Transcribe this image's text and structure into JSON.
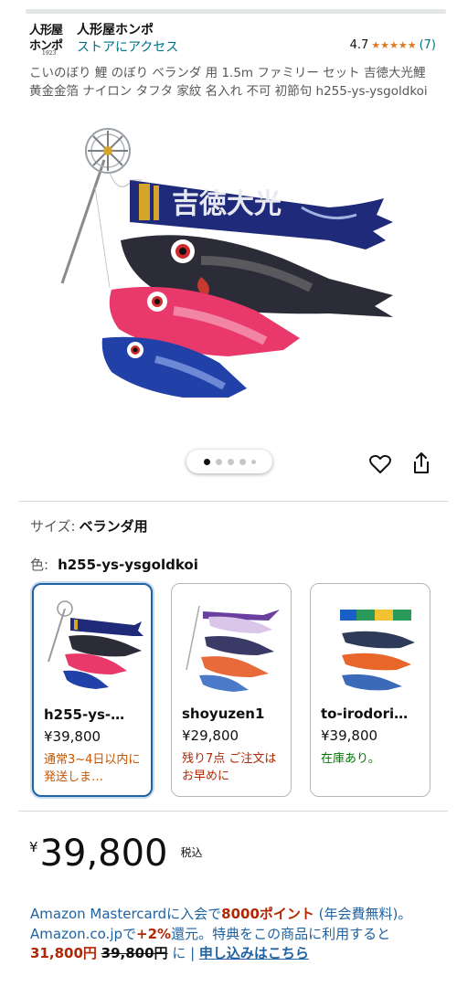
{
  "store": {
    "logo_line1": "人形屋",
    "logo_line2": "ホンポ",
    "logo_year": "1923",
    "name": "人形屋ホンポ",
    "link": "ストアにアクセス",
    "rating": "4.7",
    "stars": "★★★★★",
    "review_count": "(7)"
  },
  "product": {
    "title": "こいのぼり 鯉 のぼり ベランダ 用 1.5m ファミリー セット 吉徳大光鯉 黄金金箔 ナイロン タフタ 家紋 名入れ 不可 初節句 h255-ys-ysgoldkoi",
    "banner_text": "吉徳大光"
  },
  "carousel": {
    "dot_count": 5,
    "active_index": 0
  },
  "options": {
    "size_label": "サイズ:",
    "size_value": "ベランダ用",
    "color_label": "色:",
    "color_value": "h255-ys-ysgoldkoi",
    "swatches": [
      {
        "name": "h255-ys-…",
        "price": "¥39,800",
        "stock": "通常3~4日以内に発送しま…",
        "stock_color": "orange"
      },
      {
        "name": "shoyuzen1",
        "price": "¥29,800",
        "stock": "残り7点 ご注文はお早めに",
        "stock_color": "red"
      },
      {
        "name": "to-irodori…",
        "price": "¥39,800",
        "stock": "在庫あり。",
        "stock_color": "green"
      }
    ]
  },
  "price": {
    "currency": "¥",
    "amount": "39,800",
    "tax": "税込"
  },
  "promo": {
    "p1": "Amazon Mastercardに入会で",
    "points": "8000ポイント",
    "p2": " (年会費無料)。 Amazon.co.jpで",
    "rate": "+2%",
    "p3": "還元。特典をこの商品に利用すると",
    "discounted": "31,800円",
    "original": "39,800円",
    "p4": " に | ",
    "apply": "申し込みはこちら"
  },
  "colors": {
    "link": "#007185",
    "star": "#de7921",
    "selected_border": "#2162a1",
    "deal_red": "#b12704"
  }
}
